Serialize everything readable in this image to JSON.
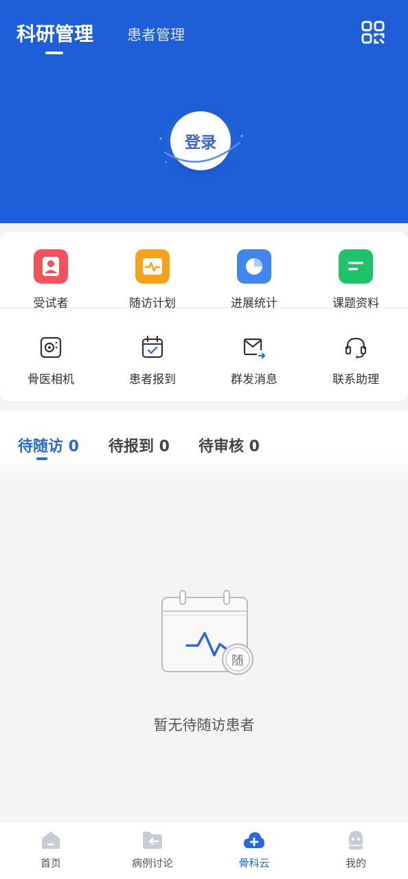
{
  "header": {
    "tabs": [
      {
        "label": "科研管理",
        "active": true
      },
      {
        "label": "患者管理",
        "active": false
      }
    ],
    "login_label": "登录",
    "scan_icon": "qr-scan-icon"
  },
  "menu": {
    "row1": [
      {
        "label": "受试者",
        "icon": "subject-person-icon",
        "color": "#f2525a"
      },
      {
        "label": "随访计划",
        "icon": "followup-plan-icon",
        "color": "#f7a21b"
      },
      {
        "label": "进展统计",
        "icon": "progress-chart-icon",
        "color": "#3f86f0"
      },
      {
        "label": "课题资料",
        "icon": "document-icon",
        "color": "#1fc46a"
      }
    ],
    "row2": [
      {
        "label": "骨医相机",
        "icon": "camera-icon"
      },
      {
        "label": "患者报到",
        "icon": "calendar-check-icon"
      },
      {
        "label": "群发消息",
        "icon": "mail-send-icon"
      },
      {
        "label": "联系助理",
        "icon": "headset-icon"
      }
    ]
  },
  "tasks": {
    "tabs": [
      {
        "label": "待随访 0",
        "active": true
      },
      {
        "label": "待报到 0",
        "active": false
      },
      {
        "label": "待审核 0",
        "active": false
      }
    ],
    "empty_badge": "随",
    "empty_text": "暂无待随访患者"
  },
  "bottom_nav": [
    {
      "label": "首页",
      "icon": "home-icon",
      "active": false
    },
    {
      "label": "病例讨论",
      "icon": "case-folder-icon",
      "active": false
    },
    {
      "label": "骨科云",
      "icon": "cloud-plus-icon",
      "active": true
    },
    {
      "label": "我的",
      "icon": "profile-icon",
      "active": false
    }
  ],
  "colors": {
    "primary": "#1e5fd9",
    "accent": "#2a67d8"
  }
}
